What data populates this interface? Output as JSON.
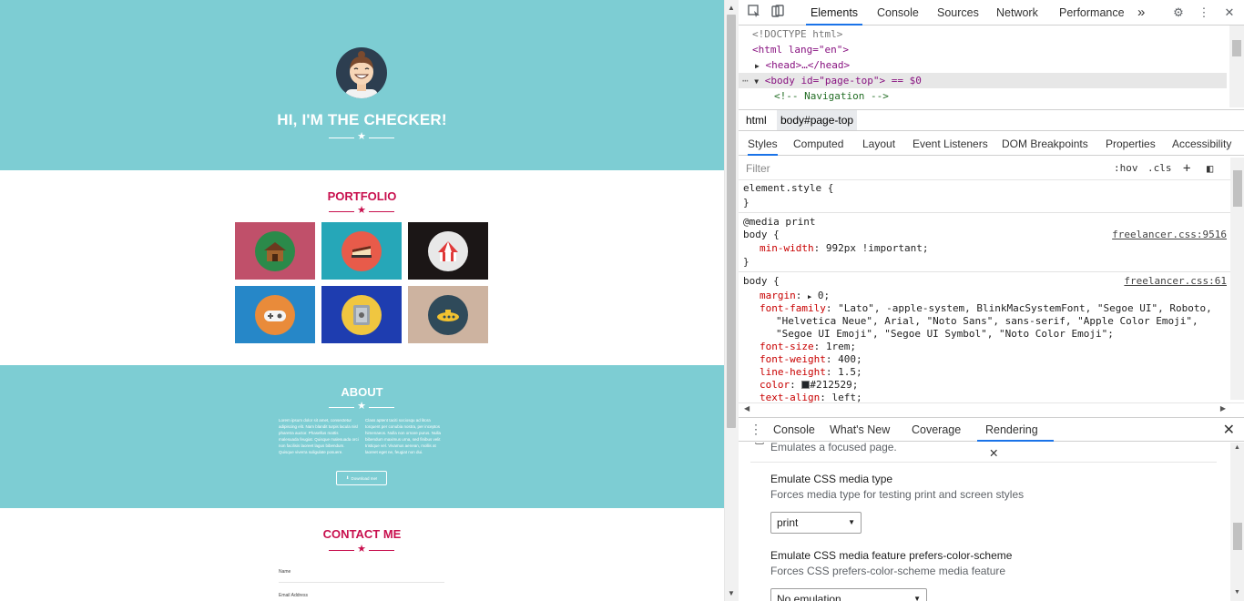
{
  "site": {
    "hero_title": "HI, I'M THE CHECKER!",
    "portfolio_title": "PORTFOLIO",
    "portfolio_items": [
      {
        "icon": "cabin-icon",
        "bg": "#c0506a",
        "disc": "#2b8a4a"
      },
      {
        "icon": "cake-icon",
        "bg": "#26a7b8",
        "disc": "#e85b4a"
      },
      {
        "icon": "circus-tent-icon",
        "bg": "#1b1616",
        "disc": "#e8e8e8"
      },
      {
        "icon": "game-controller-icon",
        "bg": "#2687c8",
        "disc": "#e98b3a"
      },
      {
        "icon": "safe-icon",
        "bg": "#1e3db0",
        "disc": "#f0c640"
      },
      {
        "icon": "submarine-icon",
        "bg": "#cdb3a0",
        "disc": "#2f4a5a"
      }
    ],
    "about_title": "ABOUT",
    "about_left": "Lorem ipsum dolor sit amet, consectetur adipiscing elit. Nam blandit turpis lacula nisl pharetra auctor. Phasellus mattis malesuada feugiat. Quisque malesuada orci non facilisis laoreet lagus bibendum. Quisque viverra suligulate posuere.",
    "about_right": "Class aptent taciti sociosqu ad litora torquent per conubia nostra, per inceptos himenaeos. Nulla non ornare purus. Nulla bibendum maximus urna, sed finibus velit tristique vel. Vivamus aenean, mollis at laoreet eget ne, feugiat non dui.",
    "download_label": "Download me!",
    "contact_title": "CONTACT ME",
    "name_label": "Name",
    "email_label": "Email Address"
  },
  "devtools": {
    "tabs": [
      "Elements",
      "Console",
      "Sources",
      "Network",
      "Performance"
    ],
    "more_tabs": "»",
    "elements": {
      "doctype": "<!DOCTYPE html>",
      "html_open": "<html lang=\"en\">",
      "head": "<head>…</head>",
      "body_open": "<body id=\"page-top\"> == $0",
      "comment": "<!-- Navigation -->"
    },
    "breadcrumbs": [
      "html",
      "body#page-top"
    ],
    "sub_tabs": [
      "Styles",
      "Computed",
      "Layout",
      "Event Listeners",
      "DOM Breakpoints",
      "Properties",
      "Accessibility"
    ],
    "filter_placeholder": "Filter",
    "hov_label": ":hov",
    "cls_label": ".cls",
    "styles": {
      "element_style": "element.style {",
      "close_brace": "}",
      "media_print": "@media print",
      "body_selector": "body {",
      "print_source": "freelancer.css:9516",
      "min_width_prop": "min-width",
      "min_width_val": "992px !important;",
      "body_source": "freelancer.css:61",
      "margin_prop": "margin",
      "margin_val": "0;",
      "font_family_prop": "font-family",
      "font_family_val1": "\"Lato\", -apple-system, BlinkMacSystemFont, \"Segoe UI\", Roboto,",
      "font_family_val2": "\"Helvetica Neue\", Arial, \"Noto Sans\", sans-serif, \"Apple Color Emoji\",",
      "font_family_val3": "\"Segoe UI Emoji\", \"Segoe UI Symbol\", \"Noto Color Emoji\";",
      "font_size_prop": "font-size",
      "font_size_val": "1rem;",
      "font_weight_prop": "font-weight",
      "font_weight_val": "400;",
      "line_height_prop": "line-height",
      "line_height_val": "1.5;",
      "color_prop": "color",
      "color_val": "#212529;",
      "text_align_prop": "text-align",
      "text_align_val": "left;"
    },
    "drawer_tabs": [
      "Console",
      "What's New",
      "Coverage",
      "Rendering"
    ],
    "rendering": {
      "focused_desc": "Emulates a focused page.",
      "media_type_title": "Emulate CSS media type",
      "media_type_desc": "Forces media type for testing print and screen styles",
      "media_type_value": "print",
      "color_scheme_title": "Emulate CSS media feature prefers-color-scheme",
      "color_scheme_desc": "Forces CSS prefers-color-scheme media feature",
      "color_scheme_value": "No emulation"
    },
    "colors": {
      "accent": "#1a73e8",
      "masthead": "#7dcdd3",
      "heading": "#c8104e"
    }
  }
}
